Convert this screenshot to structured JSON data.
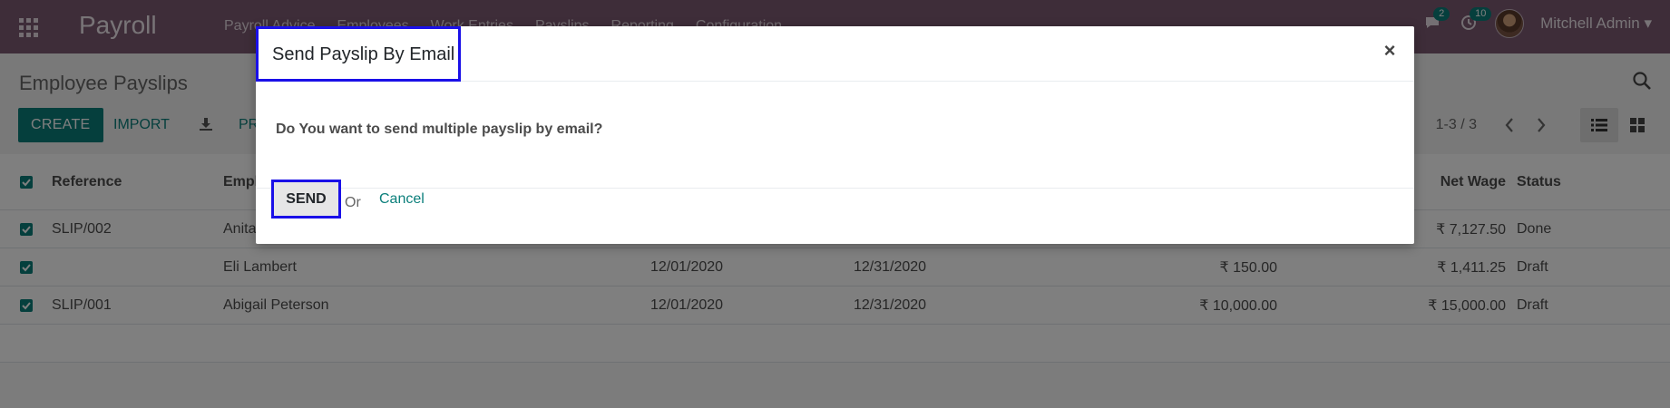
{
  "navbar": {
    "app_name": "Payroll",
    "menu_items": [
      "Payroll Advice",
      "Employees",
      "Work Entries",
      "Payslips",
      "Reporting",
      "Configuration"
    ],
    "messages_count": "2",
    "activities_count": "10",
    "user_name": "Mitchell Admin",
    "colors": {
      "bar": "#7c5a72",
      "badge": "#0b7f7b"
    }
  },
  "control_panel": {
    "title": "Employee Payslips",
    "create_label": "CREATE",
    "import_label": "IMPORT",
    "print_label": "PRINT",
    "pager": "1-3 / 3"
  },
  "table": {
    "headers": {
      "reference": "Reference",
      "employee": "Employee",
      "net_wage": "Net Wage",
      "status": "Status"
    },
    "rows": [
      {
        "reference": "SLIP/002",
        "employee": "Anita Oliver",
        "date_from": "",
        "date_to": "",
        "basic": "",
        "net": "₹ 7,127.50",
        "status": "Done"
      },
      {
        "reference": "",
        "employee": "Eli Lambert",
        "date_from": "12/01/2020",
        "date_to": "12/31/2020",
        "basic": "₹ 150.00",
        "net": "₹ 1,411.25",
        "status": "Draft"
      },
      {
        "reference": "SLIP/001",
        "employee": "Abigail Peterson",
        "date_from": "12/01/2020",
        "date_to": "12/31/2020",
        "basic": "₹ 10,000.00",
        "net": "₹ 15,000.00",
        "status": "Draft"
      }
    ]
  },
  "modal": {
    "title": "Send Payslip By Email",
    "question": "Do You want to send multiple payslip by email?",
    "send_label": "SEND",
    "or_text": "Or",
    "cancel_label": "Cancel",
    "close_glyph": "×"
  },
  "accent_color": "#0b7f7b",
  "highlight_color": "#1a10e8"
}
